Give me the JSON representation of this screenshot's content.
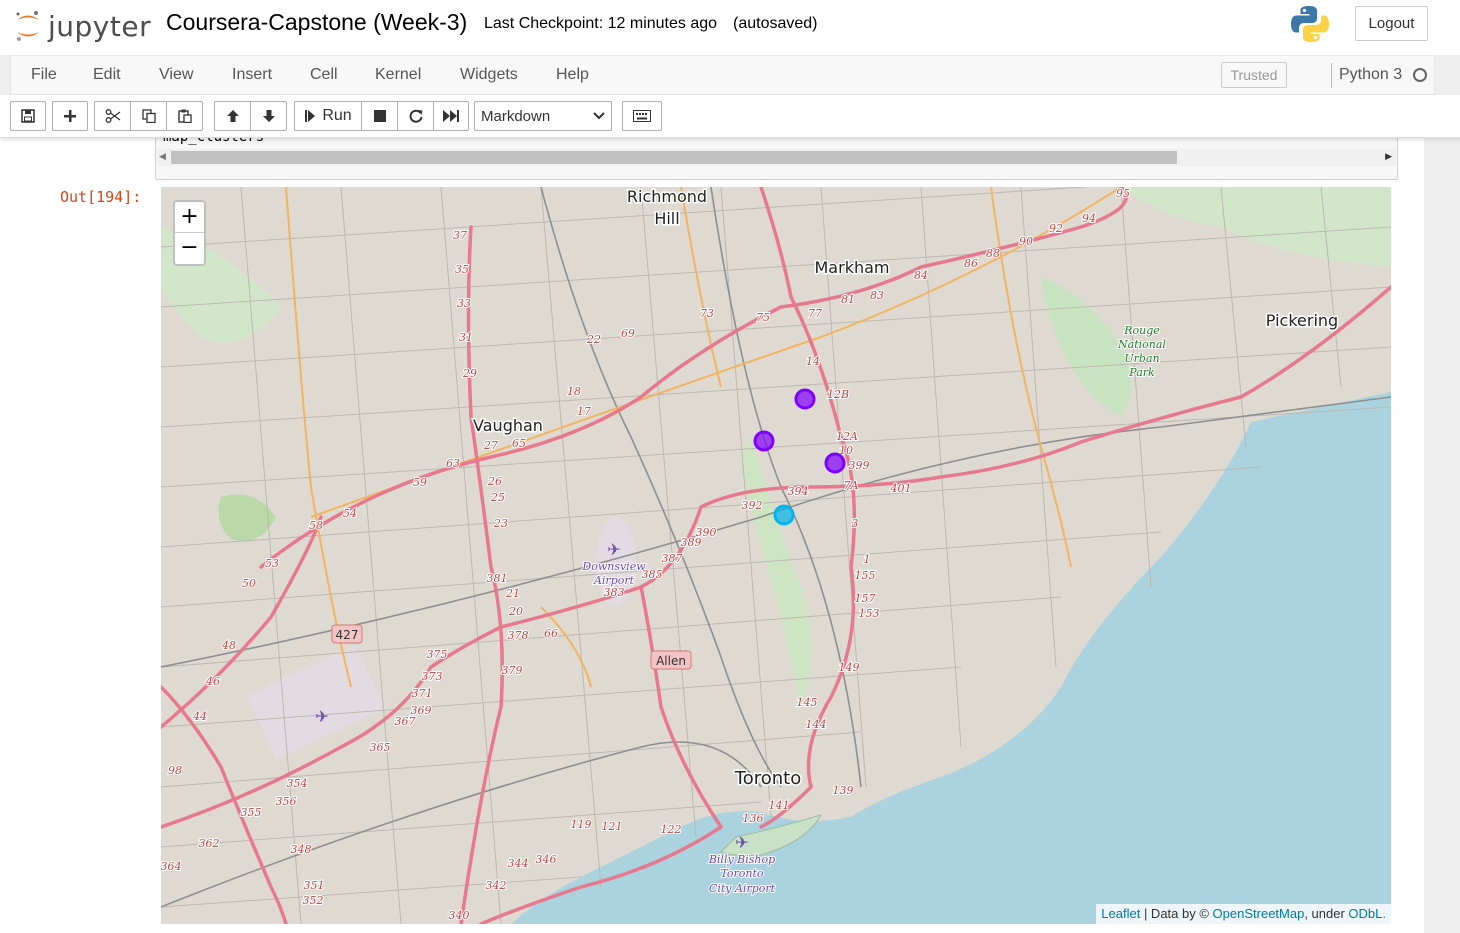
{
  "header": {
    "logo_text": "jupyter",
    "notebook_title": "Coursera-Capstone (Week-3)",
    "checkpoint": "Last Checkpoint: 12 minutes ago",
    "autosave_status": "(autosaved)",
    "logout_label": "Logout"
  },
  "menubar": {
    "items": [
      "File",
      "Edit",
      "View",
      "Insert",
      "Cell",
      "Kernel",
      "Widgets",
      "Help"
    ],
    "trusted_label": "Trusted",
    "kernel_name": "Python 3"
  },
  "toolbar": {
    "run_label": "Run",
    "cell_type": "Markdown",
    "icons": [
      "save-icon",
      "plus-icon",
      "cut-icon",
      "copy-icon",
      "paste-icon",
      "arrow-up-icon",
      "arrow-down-icon",
      "step-icon",
      "stop-icon",
      "restart-icon",
      "fast-forward-icon",
      "keyboard-icon"
    ]
  },
  "cell": {
    "code": "map_clusters",
    "output_prompt": "Out[194]:"
  },
  "map": {
    "place_labels": {
      "richmond": "Richmond",
      "hill": "Hill",
      "markham": "Markham",
      "vaughan": "Vaughan",
      "pickering": "Pickering",
      "toronto": "Toronto",
      "rouge1": "Rouge",
      "rouge2": "National",
      "rouge3": "Urban",
      "rouge4": "Park",
      "downsview1": "Downsview",
      "downsview2": "Airport",
      "billy1": "Billy Bishop",
      "billy2": "Toronto",
      "billy3": "City Airport",
      "hw427": "427",
      "allen": "Allen"
    },
    "route_numbers": [
      "37",
      "35",
      "33",
      "31",
      "29",
      "27",
      "26",
      "25",
      "23",
      "21",
      "20",
      "66",
      "65",
      "63",
      "59",
      "58",
      "54",
      "53",
      "50",
      "48",
      "46",
      "44",
      "98",
      "95",
      "94",
      "92",
      "90",
      "88",
      "86",
      "84",
      "83",
      "81",
      "77",
      "75",
      "73",
      "69",
      "22",
      "18",
      "17",
      "14",
      "12B",
      "12A",
      "10",
      "7A",
      "3",
      "1",
      "155",
      "157",
      "153",
      "149",
      "145",
      "144",
      "141",
      "139",
      "136",
      "122",
      "121",
      "119",
      "346",
      "344",
      "342",
      "340",
      "348",
      "351",
      "352",
      "354",
      "356",
      "355",
      "362",
      "364",
      "365",
      "367",
      "369",
      "371",
      "373",
      "375",
      "378",
      "379",
      "381",
      "383",
      "385",
      "387",
      "389",
      "390",
      "392",
      "394",
      "399",
      "401"
    ],
    "cluster_markers": [
      {
        "cluster": 1,
        "color": "#8000ff"
      },
      {
        "cluster": 1,
        "color": "#8000ff"
      },
      {
        "cluster": 1,
        "color": "#8000ff"
      },
      {
        "cluster": 2,
        "color": "#00b5eb"
      }
    ],
    "zoom_in": "+",
    "zoom_out": "−",
    "attribution": {
      "leaflet": "Leaflet",
      "data_by": " | Data by © ",
      "osm": "OpenStreetMap",
      "under": ", under ",
      "odbl": "ODbL."
    }
  }
}
